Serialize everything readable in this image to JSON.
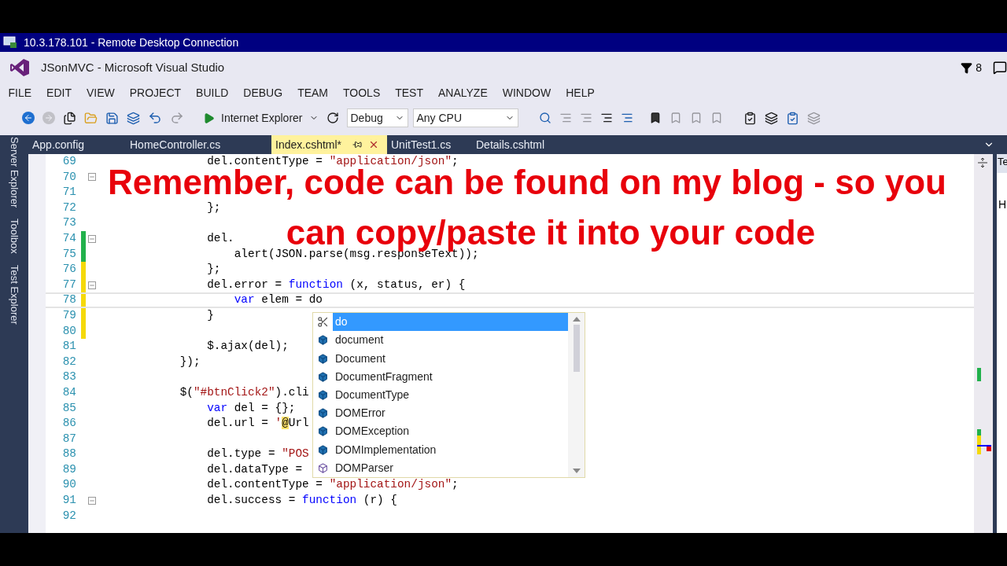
{
  "remote_window": {
    "title": "10.3.178.101 - Remote Desktop Connection"
  },
  "vs_window": {
    "title": "JSonMVC - Microsoft Visual Studio",
    "notification_count": "8"
  },
  "menu": [
    "FILE",
    "EDIT",
    "VIEW",
    "PROJECT",
    "BUILD",
    "DEBUG",
    "TEAM",
    "TOOLS",
    "TEST",
    "ANALYZE",
    "WINDOW",
    "HELP"
  ],
  "toolbar": {
    "run_target": "Internet Explorer",
    "configuration": "Debug",
    "platform": "Any CPU"
  },
  "side_panels": [
    "Server Explorer",
    "Toolbox",
    "Test Explorer"
  ],
  "tabs": [
    {
      "label": "App.config",
      "selected": false
    },
    {
      "label": "HomeController.cs",
      "selected": false
    },
    {
      "label": "Index.cshtml*",
      "selected": true
    },
    {
      "label": "UnitTest1.cs",
      "selected": false
    },
    {
      "label": "Details.cshtml",
      "selected": false
    }
  ],
  "right_panel": {
    "tab": "Te",
    "text": "H"
  },
  "editor": {
    "lines": [
      {
        "number": "69",
        "foldable": false,
        "current": false,
        "tokens": [
          {
            "kind": "plain",
            "text": "                del.contentType = "
          },
          {
            "kind": "string",
            "text": "\"application/json\""
          },
          {
            "kind": "plain",
            "text": ";"
          }
        ]
      },
      {
        "number": "70",
        "foldable": true,
        "current": false
      },
      {
        "number": "71",
        "foldable": false,
        "current": false
      },
      {
        "number": "72",
        "foldable": false,
        "current": false,
        "tokens": [
          {
            "kind": "plain",
            "text": "                };"
          }
        ]
      },
      {
        "number": "73",
        "foldable": false,
        "current": false
      },
      {
        "number": "74",
        "color": "#22b14c",
        "foldable": true,
        "current": false,
        "tokens": [
          {
            "kind": "plain",
            "text": "                del."
          }
        ]
      },
      {
        "number": "75",
        "color": "#22b14c",
        "foldable": false,
        "current": false,
        "tokens": [
          {
            "kind": "plain",
            "text": "                    alert(JSON.parse(msg.responseText));"
          }
        ]
      },
      {
        "number": "76",
        "color": "#f5d90a",
        "foldable": false,
        "current": false,
        "tokens": [
          {
            "kind": "plain",
            "text": "                };"
          }
        ]
      },
      {
        "number": "77",
        "color": "#f5d90a",
        "foldable": true,
        "current": false,
        "tokens": [
          {
            "kind": "plain",
            "text": "                del.error = "
          },
          {
            "kind": "keyword",
            "text": "function"
          },
          {
            "kind": "plain",
            "text": " (x, status, er) {"
          }
        ]
      },
      {
        "number": "78",
        "color": "#f5d90a",
        "foldable": false,
        "current": true,
        "tokens": [
          {
            "kind": "keyword",
            "text": "                    var"
          },
          {
            "kind": "plain",
            "text": " elem = do"
          }
        ]
      },
      {
        "number": "79",
        "color": "#f5d90a",
        "foldable": false,
        "current": false,
        "tokens": [
          {
            "kind": "plain",
            "text": "                }"
          }
        ]
      },
      {
        "number": "80",
        "color": "#f5d90a",
        "foldable": false,
        "current": false
      },
      {
        "number": "81",
        "foldable": false,
        "current": false,
        "tokens": [
          {
            "kind": "plain",
            "text": "                $.ajax(del);"
          }
        ]
      },
      {
        "number": "82",
        "foldable": false,
        "current": false,
        "tokens": [
          {
            "kind": "plain",
            "text": "            });"
          }
        ]
      },
      {
        "number": "83",
        "foldable": false,
        "current": false
      },
      {
        "number": "84",
        "foldable": false,
        "current": false,
        "tokens": [
          {
            "kind": "plain",
            "text": "            $("
          },
          {
            "kind": "string",
            "text": "\"#btnClick2\""
          },
          {
            "kind": "plain",
            "text": ").cli"
          }
        ]
      },
      {
        "number": "85",
        "foldable": false,
        "current": false,
        "tokens": [
          {
            "kind": "keyword",
            "text": "                var"
          },
          {
            "kind": "plain",
            "text": " del = {};"
          }
        ]
      },
      {
        "number": "86",
        "foldable": false,
        "current": false,
        "tokens": [
          {
            "kind": "plain",
            "text": "                del.url = "
          },
          {
            "kind": "string",
            "text": "'"
          },
          {
            "kind": "razor",
            "text": "@"
          },
          {
            "kind": "plain",
            "text": "Url"
          }
        ]
      },
      {
        "number": "87",
        "foldable": false,
        "current": false
      },
      {
        "number": "88",
        "foldable": false,
        "current": false,
        "tokens": [
          {
            "kind": "plain",
            "text": "                del.type = "
          },
          {
            "kind": "string",
            "text": "\"POS"
          }
        ]
      },
      {
        "number": "89",
        "foldable": false,
        "current": false,
        "tokens": [
          {
            "kind": "plain",
            "text": "                del.dataType ="
          }
        ]
      },
      {
        "number": "90",
        "foldable": false,
        "current": false,
        "tokens": [
          {
            "kind": "plain",
            "text": "                del.contentType = "
          },
          {
            "kind": "string",
            "text": "\"application/json\""
          },
          {
            "kind": "plain",
            "text": ";"
          }
        ]
      },
      {
        "number": "91",
        "foldable": true,
        "current": false,
        "tokens": [
          {
            "kind": "plain",
            "text": "                del.success = "
          },
          {
            "kind": "keyword",
            "text": "function"
          },
          {
            "kind": "plain",
            "text": " (r) {"
          }
        ]
      },
      {
        "number": "92",
        "foldable": false,
        "current": false
      }
    ]
  },
  "completion": [
    {
      "label": "do",
      "kind": "snippet",
      "selected": true
    },
    {
      "label": "document",
      "kind": "object",
      "selected": false
    },
    {
      "label": "Document",
      "kind": "object",
      "selected": false
    },
    {
      "label": "DocumentFragment",
      "kind": "object",
      "selected": false
    },
    {
      "label": "DocumentType",
      "kind": "object",
      "selected": false
    },
    {
      "label": "DOMError",
      "kind": "object",
      "selected": false
    },
    {
      "label": "DOMException",
      "kind": "object",
      "selected": false
    },
    {
      "label": "DOMImplementation",
      "kind": "object",
      "selected": false
    },
    {
      "label": "DOMParser",
      "kind": "class",
      "selected": false
    }
  ],
  "caption": [
    "Remember, code can be found on my blog - so you",
    "can copy/paste it into your code"
  ]
}
